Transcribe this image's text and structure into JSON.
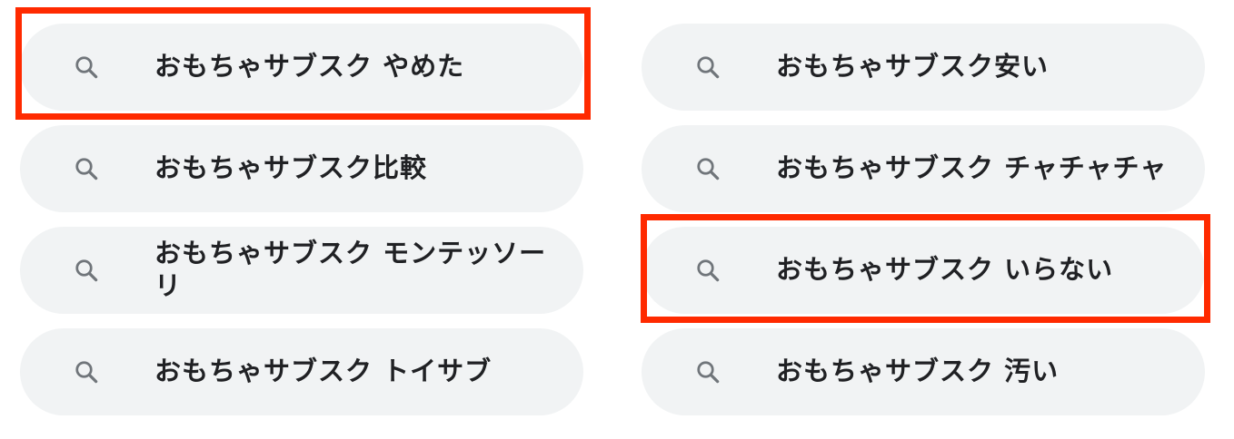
{
  "suggestions": {
    "left": [
      {
        "label": "おもちゃサブスク やめた",
        "icon": "search-icon",
        "highlighted": true
      },
      {
        "label": "おもちゃサブスク比較",
        "icon": "search-icon",
        "highlighted": false
      },
      {
        "label": "おもちゃサブスク モンテッソーリ",
        "icon": "search-icon",
        "highlighted": false
      },
      {
        "label": "おもちゃサブスク トイサブ",
        "icon": "search-icon",
        "highlighted": false
      }
    ],
    "right": [
      {
        "label": "おもちゃサブスク安い",
        "icon": "search-icon",
        "highlighted": false
      },
      {
        "label": "おもちゃサブスク チャチャチャ",
        "icon": "search-icon",
        "highlighted": false
      },
      {
        "label": "おもちゃサブスク いらない",
        "icon": "search-icon",
        "highlighted": true
      },
      {
        "label": "おもちゃサブスク 汚い",
        "icon": "search-icon",
        "highlighted": false
      }
    ]
  },
  "colors": {
    "chip_background": "#f1f3f4",
    "text": "#202124",
    "icon": "#70757a",
    "highlight_border": "#ff2a00"
  }
}
